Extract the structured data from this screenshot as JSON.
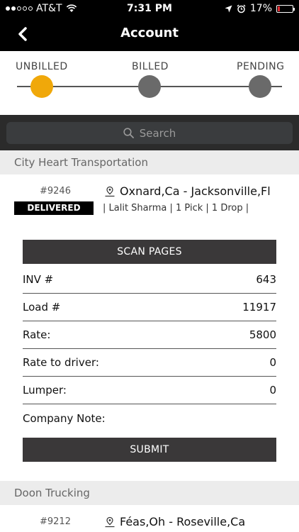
{
  "status_bar": {
    "carrier": "AT&T",
    "time": "7:31 PM",
    "battery": "17%",
    "battery_level": 0.17,
    "battery_color": "#e0282e"
  },
  "nav": {
    "title": "Account",
    "back_icon": "chevron-left-icon"
  },
  "steps": [
    {
      "label": "UNBILLED",
      "active": true
    },
    {
      "label": "BILLED",
      "active": false
    },
    {
      "label": "PENDING",
      "active": false
    }
  ],
  "colors": {
    "active_step": "#f0a80a",
    "inactive_step": "#6a6a6a"
  },
  "search": {
    "placeholder": "Search"
  },
  "sections": [
    {
      "company": "City Heart Transportation",
      "order": {
        "id": "#9246",
        "status": "DELIVERED",
        "route": "Oxnard,Ca - Jacksonville,Fl",
        "meta": "| Lalit Sharma | 1 Pick | 1 Drop |"
      },
      "scan_button": "SCAN PAGES",
      "fields": [
        {
          "label": "INV #",
          "value": "643"
        },
        {
          "label": "Load #",
          "value": "11917"
        },
        {
          "label": "Rate:",
          "value": "5800"
        },
        {
          "label": "Rate to driver:",
          "value": "0"
        },
        {
          "label": "Lumper:",
          "value": "0"
        },
        {
          "label": "Company Note:",
          "value": ""
        }
      ],
      "submit_button": "SUBMIT"
    },
    {
      "company": "Doon Trucking",
      "order": {
        "id": "#9212",
        "route": "Féas,Oh - Roseville,Ca"
      }
    }
  ]
}
